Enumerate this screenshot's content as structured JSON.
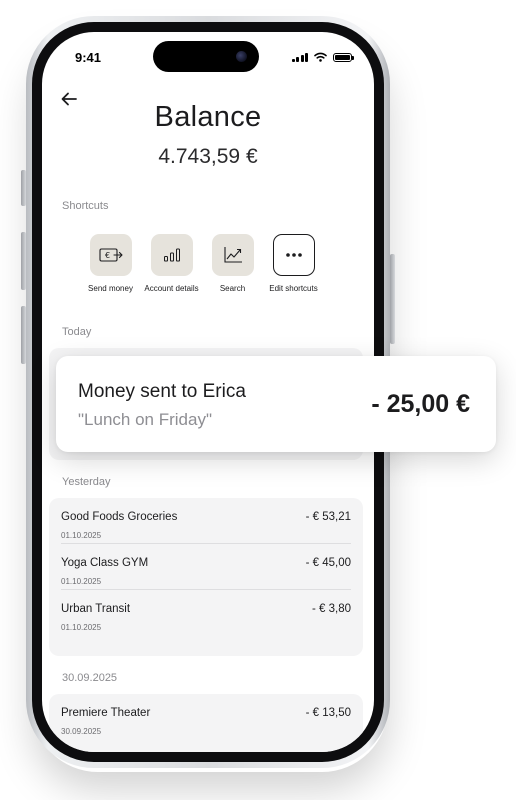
{
  "status_bar": {
    "time": "9:41"
  },
  "header": {
    "title": "Balance",
    "balance": "4.743,59 €"
  },
  "shortcuts": {
    "label": "Shortcuts",
    "items": [
      {
        "label": "Send money",
        "icon": "send-money-icon"
      },
      {
        "label": "Account details",
        "icon": "bar-chart-icon"
      },
      {
        "label": "Search",
        "icon": "trend-chart-icon"
      },
      {
        "label": "Edit shortcuts",
        "icon": "more-dots-icon"
      }
    ]
  },
  "sections": {
    "today": "Today",
    "yesterday": "Yesterday",
    "older": "30.09.2025"
  },
  "highlight": {
    "title": "Money sent to Erica",
    "note": "\"Lunch on Friday\"",
    "amount": "- 25,00 €"
  },
  "yesterday_transactions": [
    {
      "name": "Good Foods Groceries",
      "date": "01.10.2025",
      "amount": "- € 53,21"
    },
    {
      "name": "Yoga Class GYM",
      "date": "01.10.2025",
      "amount": "- € 45,00"
    },
    {
      "name": "Urban Transit",
      "date": "01.10.2025",
      "amount": "- € 3,80"
    }
  ],
  "older_transactions": [
    {
      "name": "Premiere Theater",
      "date": "30.09.2025",
      "amount": "- € 13,50"
    }
  ],
  "colors": {
    "tile_bg": "#e6e3dc",
    "card_bg": "#f4f4f5",
    "text": "#1c1c1e"
  }
}
